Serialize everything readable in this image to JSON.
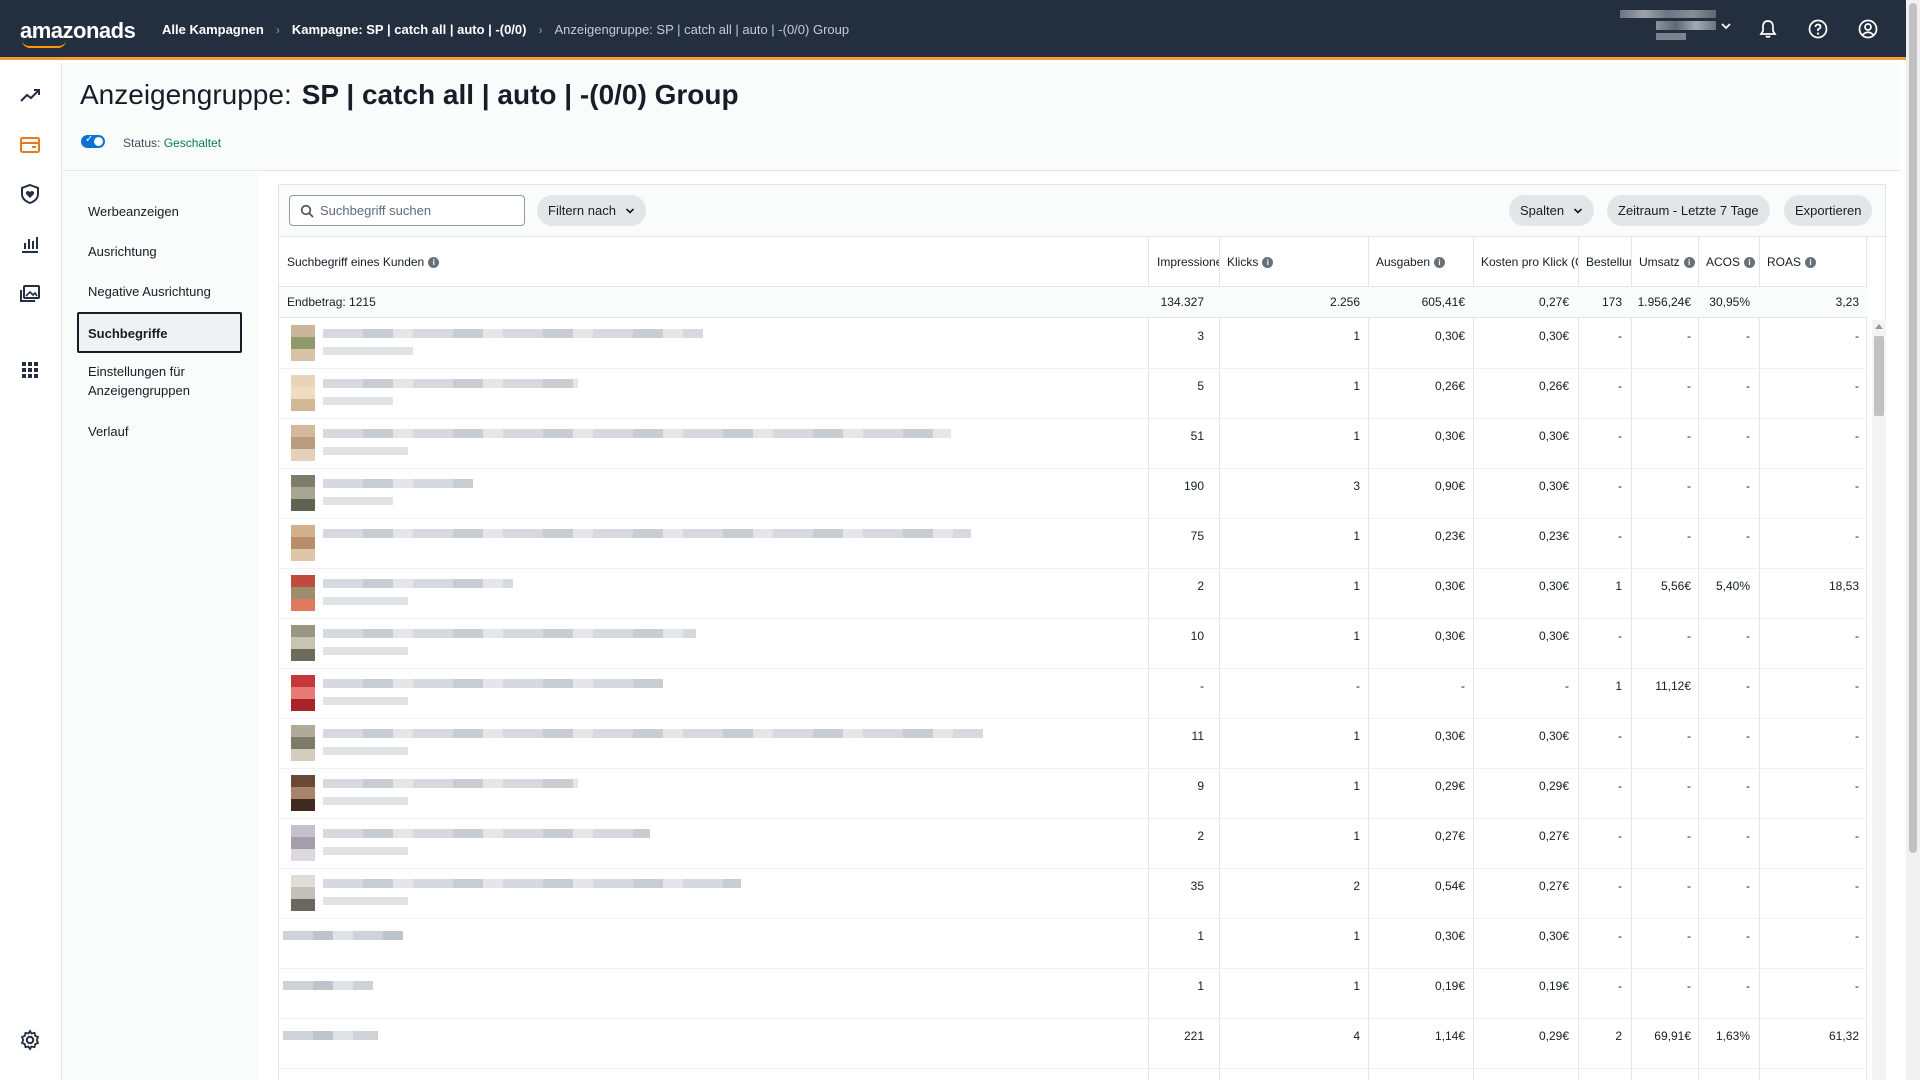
{
  "topbar": {
    "logo": "amazonads",
    "breadcrumbs": [
      "Alle Kampagnen",
      "Kampagne: SP | catch all | auto | -(0/0)",
      "Anzeigengruppe: SP | catch all | auto | -(0/0) Group"
    ]
  },
  "header": {
    "title_prefix": "Anzeigengruppe:",
    "title_name": "SP | catch all | auto | -(0/0) Group",
    "status_label": "Status:",
    "status_value": "Geschaltet"
  },
  "subnav": {
    "items": [
      "Werbeanzeigen",
      "Ausrichtung",
      "Negative Ausrichtung",
      "Suchbegriffe",
      "Einstellungen für Anzeigengruppen",
      "Verlauf"
    ],
    "active": "Suchbegriffe"
  },
  "toolbar": {
    "search_placeholder": "Suchbegriff suchen",
    "filter_label": "Filtern nach",
    "columns_label": "Spalten",
    "date_range_label": "Zeitraum - Letzte 7 Tage",
    "export_label": "Exportieren"
  },
  "table": {
    "columns": [
      "Suchbegriff eines Kunden",
      "Impressionen",
      "Klicks",
      "Ausgaben",
      "Kosten pro Klick (CPC)",
      "Bestellungen",
      "Umsatz",
      "ACOS",
      "ROAS"
    ],
    "totals": {
      "label": "Endbetrag: 1215",
      "values": [
        "134.327",
        "2.256",
        "605,41€",
        "0,27€",
        "173",
        "1.956,24€",
        "30,95%",
        "3,23"
      ]
    },
    "rows": [
      {
        "values": [
          "3",
          "1",
          "0,30€",
          "0,30€",
          "-",
          "-",
          "-",
          "-"
        ]
      },
      {
        "values": [
          "5",
          "1",
          "0,26€",
          "0,26€",
          "-",
          "-",
          "-",
          "-"
        ]
      },
      {
        "values": [
          "51",
          "1",
          "0,30€",
          "0,30€",
          "-",
          "-",
          "-",
          "-"
        ]
      },
      {
        "values": [
          "190",
          "3",
          "0,90€",
          "0,30€",
          "-",
          "-",
          "-",
          "-"
        ]
      },
      {
        "values": [
          "75",
          "1",
          "0,23€",
          "0,23€",
          "-",
          "-",
          "-",
          "-"
        ]
      },
      {
        "values": [
          "2",
          "1",
          "0,30€",
          "0,30€",
          "1",
          "5,56€",
          "5,40%",
          "18,53"
        ]
      },
      {
        "values": [
          "10",
          "1",
          "0,30€",
          "0,30€",
          "-",
          "-",
          "-",
          "-"
        ]
      },
      {
        "values": [
          "-",
          "-",
          "-",
          "-",
          "1",
          "11,12€",
          "-",
          "-"
        ]
      },
      {
        "values": [
          "11",
          "1",
          "0,30€",
          "0,30€",
          "-",
          "-",
          "-",
          "-"
        ]
      },
      {
        "values": [
          "9",
          "1",
          "0,29€",
          "0,29€",
          "-",
          "-",
          "-",
          "-"
        ]
      },
      {
        "values": [
          "2",
          "1",
          "0,27€",
          "0,27€",
          "-",
          "-",
          "-",
          "-"
        ]
      },
      {
        "values": [
          "35",
          "2",
          "0,54€",
          "0,27€",
          "-",
          "-",
          "-",
          "-"
        ]
      },
      {
        "values": [
          "1",
          "1",
          "0,30€",
          "0,30€",
          "-",
          "-",
          "-",
          "-"
        ]
      },
      {
        "values": [
          "1",
          "1",
          "0,19€",
          "0,19€",
          "-",
          "-",
          "-",
          "-"
        ]
      },
      {
        "values": [
          "221",
          "4",
          "1,14€",
          "0,29€",
          "2",
          "69,91€",
          "1,63%",
          "61,32"
        ]
      }
    ]
  }
}
